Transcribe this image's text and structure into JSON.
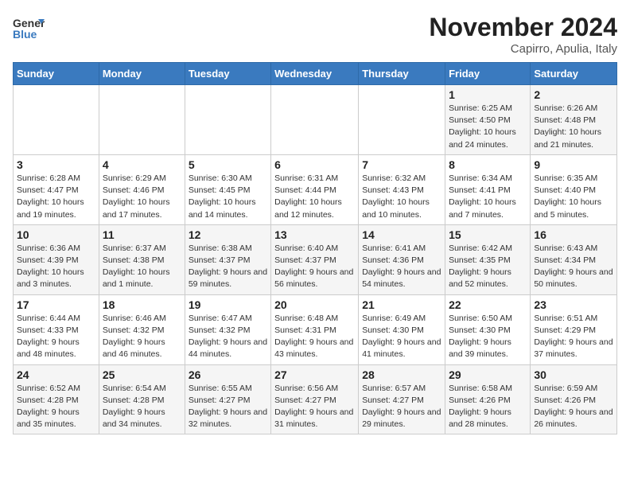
{
  "header": {
    "logo_line1": "General",
    "logo_line2": "Blue",
    "month": "November 2024",
    "location": "Capirro, Apulia, Italy"
  },
  "days_of_week": [
    "Sunday",
    "Monday",
    "Tuesday",
    "Wednesday",
    "Thursday",
    "Friday",
    "Saturday"
  ],
  "weeks": [
    [
      {
        "day": "",
        "info": ""
      },
      {
        "day": "",
        "info": ""
      },
      {
        "day": "",
        "info": ""
      },
      {
        "day": "",
        "info": ""
      },
      {
        "day": "",
        "info": ""
      },
      {
        "day": "1",
        "info": "Sunrise: 6:25 AM\nSunset: 4:50 PM\nDaylight: 10 hours and 24 minutes."
      },
      {
        "day": "2",
        "info": "Sunrise: 6:26 AM\nSunset: 4:48 PM\nDaylight: 10 hours and 21 minutes."
      }
    ],
    [
      {
        "day": "3",
        "info": "Sunrise: 6:28 AM\nSunset: 4:47 PM\nDaylight: 10 hours and 19 minutes."
      },
      {
        "day": "4",
        "info": "Sunrise: 6:29 AM\nSunset: 4:46 PM\nDaylight: 10 hours and 17 minutes."
      },
      {
        "day": "5",
        "info": "Sunrise: 6:30 AM\nSunset: 4:45 PM\nDaylight: 10 hours and 14 minutes."
      },
      {
        "day": "6",
        "info": "Sunrise: 6:31 AM\nSunset: 4:44 PM\nDaylight: 10 hours and 12 minutes."
      },
      {
        "day": "7",
        "info": "Sunrise: 6:32 AM\nSunset: 4:43 PM\nDaylight: 10 hours and 10 minutes."
      },
      {
        "day": "8",
        "info": "Sunrise: 6:34 AM\nSunset: 4:41 PM\nDaylight: 10 hours and 7 minutes."
      },
      {
        "day": "9",
        "info": "Sunrise: 6:35 AM\nSunset: 4:40 PM\nDaylight: 10 hours and 5 minutes."
      }
    ],
    [
      {
        "day": "10",
        "info": "Sunrise: 6:36 AM\nSunset: 4:39 PM\nDaylight: 10 hours and 3 minutes."
      },
      {
        "day": "11",
        "info": "Sunrise: 6:37 AM\nSunset: 4:38 PM\nDaylight: 10 hours and 1 minute."
      },
      {
        "day": "12",
        "info": "Sunrise: 6:38 AM\nSunset: 4:37 PM\nDaylight: 9 hours and 59 minutes."
      },
      {
        "day": "13",
        "info": "Sunrise: 6:40 AM\nSunset: 4:37 PM\nDaylight: 9 hours and 56 minutes."
      },
      {
        "day": "14",
        "info": "Sunrise: 6:41 AM\nSunset: 4:36 PM\nDaylight: 9 hours and 54 minutes."
      },
      {
        "day": "15",
        "info": "Sunrise: 6:42 AM\nSunset: 4:35 PM\nDaylight: 9 hours and 52 minutes."
      },
      {
        "day": "16",
        "info": "Sunrise: 6:43 AM\nSunset: 4:34 PM\nDaylight: 9 hours and 50 minutes."
      }
    ],
    [
      {
        "day": "17",
        "info": "Sunrise: 6:44 AM\nSunset: 4:33 PM\nDaylight: 9 hours and 48 minutes."
      },
      {
        "day": "18",
        "info": "Sunrise: 6:46 AM\nSunset: 4:32 PM\nDaylight: 9 hours and 46 minutes."
      },
      {
        "day": "19",
        "info": "Sunrise: 6:47 AM\nSunset: 4:32 PM\nDaylight: 9 hours and 44 minutes."
      },
      {
        "day": "20",
        "info": "Sunrise: 6:48 AM\nSunset: 4:31 PM\nDaylight: 9 hours and 43 minutes."
      },
      {
        "day": "21",
        "info": "Sunrise: 6:49 AM\nSunset: 4:30 PM\nDaylight: 9 hours and 41 minutes."
      },
      {
        "day": "22",
        "info": "Sunrise: 6:50 AM\nSunset: 4:30 PM\nDaylight: 9 hours and 39 minutes."
      },
      {
        "day": "23",
        "info": "Sunrise: 6:51 AM\nSunset: 4:29 PM\nDaylight: 9 hours and 37 minutes."
      }
    ],
    [
      {
        "day": "24",
        "info": "Sunrise: 6:52 AM\nSunset: 4:28 PM\nDaylight: 9 hours and 35 minutes."
      },
      {
        "day": "25",
        "info": "Sunrise: 6:54 AM\nSunset: 4:28 PM\nDaylight: 9 hours and 34 minutes."
      },
      {
        "day": "26",
        "info": "Sunrise: 6:55 AM\nSunset: 4:27 PM\nDaylight: 9 hours and 32 minutes."
      },
      {
        "day": "27",
        "info": "Sunrise: 6:56 AM\nSunset: 4:27 PM\nDaylight: 9 hours and 31 minutes."
      },
      {
        "day": "28",
        "info": "Sunrise: 6:57 AM\nSunset: 4:27 PM\nDaylight: 9 hours and 29 minutes."
      },
      {
        "day": "29",
        "info": "Sunrise: 6:58 AM\nSunset: 4:26 PM\nDaylight: 9 hours and 28 minutes."
      },
      {
        "day": "30",
        "info": "Sunrise: 6:59 AM\nSunset: 4:26 PM\nDaylight: 9 hours and 26 minutes."
      }
    ]
  ]
}
